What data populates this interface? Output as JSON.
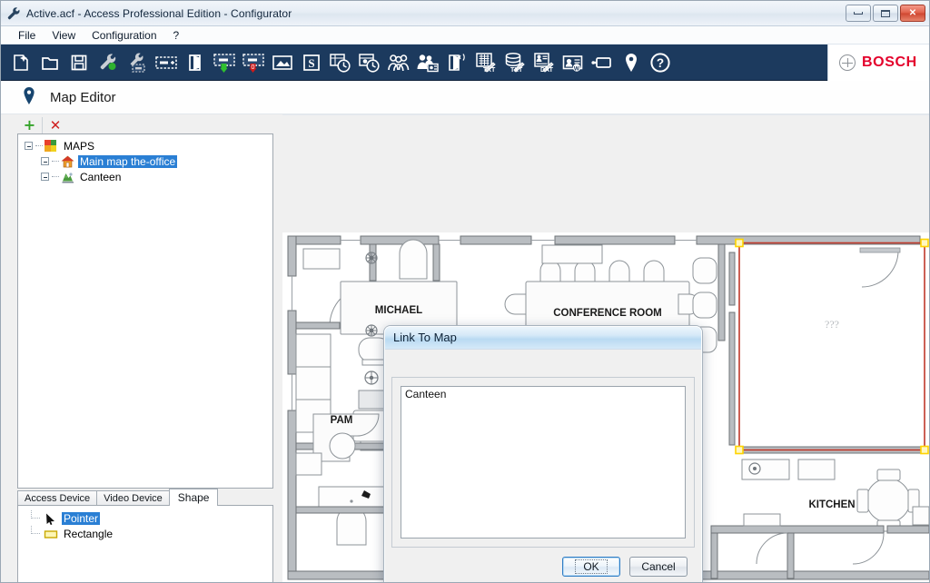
{
  "window": {
    "title": "Active.acf - Access Professional Edition - Configurator",
    "icon": "wrench-icon",
    "controls": {
      "minimize": "minimize-button",
      "maximize": "maximize-button",
      "close": "close-button"
    }
  },
  "menubar": {
    "items": [
      {
        "label": "File"
      },
      {
        "label": "View"
      },
      {
        "label": "Configuration"
      },
      {
        "label": "?"
      }
    ]
  },
  "toolbar": {
    "buttons": [
      {
        "icon": "new-file-icon",
        "tip": "New"
      },
      {
        "icon": "open-folder-icon",
        "tip": "Open"
      },
      {
        "icon": "save-floppy-icon",
        "tip": "Save"
      },
      {
        "icon": "wrench-green-icon",
        "tip": "System parameters"
      },
      {
        "icon": "wrench-card-icon",
        "tip": "Card definition"
      },
      {
        "icon": "card-reader-icon",
        "tip": "Entrances"
      },
      {
        "icon": "door-icon",
        "tip": "Doors"
      },
      {
        "icon": "card-green-arrow-icon",
        "tip": "Entrance"
      },
      {
        "icon": "card-red-arrow-icon",
        "tip": "Exit"
      },
      {
        "icon": "area-icon",
        "tip": "Areas"
      },
      {
        "icon": "s-calendar-icon",
        "tip": "Special days"
      },
      {
        "icon": "day-model-clock-icon",
        "tip": "Day models"
      },
      {
        "icon": "time-model-clock-icon",
        "tip": "Time models"
      },
      {
        "icon": "persons-group-icon",
        "tip": "Person groups"
      },
      {
        "icon": "person-card-icon",
        "tip": "Personnel"
      },
      {
        "icon": "reader-signal-icon",
        "tip": "Reader configuration"
      },
      {
        "icon": "txt-report-icon",
        "tip": "Text export"
      },
      {
        "icon": "db-txt-icon",
        "tip": "Database text"
      },
      {
        "icon": "data-report-icon",
        "tip": "Data export"
      },
      {
        "icon": "card-w-icon",
        "tip": "Word badge"
      },
      {
        "icon": "video-camera-icon",
        "tip": "Video devices"
      },
      {
        "icon": "map-pin-icon",
        "tip": "Map editor"
      },
      {
        "icon": "help-question-icon",
        "tip": "Help"
      }
    ],
    "brand": {
      "name": "BOSCH",
      "color": "#e4002b",
      "emblem": "bosch-emblem-icon"
    }
  },
  "page": {
    "icon": "map-pin-icon",
    "title": "Map Editor"
  },
  "tree_toolbar": {
    "add": {
      "icon": "plus-icon",
      "label": "+"
    },
    "delete": {
      "icon": "delete-x-icon",
      "label": "✕"
    }
  },
  "tree": {
    "nodes": [
      {
        "label": "MAPS",
        "level": 0,
        "icon": "maps-folder-icon",
        "selected": false,
        "expanded": true
      },
      {
        "label": "Main map the-office",
        "level": 1,
        "icon": "house-icon",
        "selected": true,
        "expanded": true
      },
      {
        "label": "Canteen",
        "level": 1,
        "icon": "canteen-icon",
        "selected": false,
        "expanded": true
      }
    ]
  },
  "panel_tabs": {
    "items": [
      {
        "label": "Access Device",
        "active": false
      },
      {
        "label": "Video Device",
        "active": false
      },
      {
        "label": "Shape",
        "active": true
      }
    ]
  },
  "shape_list": {
    "items": [
      {
        "label": "Pointer",
        "icon": "pointer-arrow-icon",
        "selected": true
      },
      {
        "label": "Rectangle",
        "icon": "yellow-rectangle-icon",
        "selected": false
      }
    ]
  },
  "map_canvas": {
    "background_color": "#f0f0f0",
    "room_labels": [
      {
        "text": "MICHAEL"
      },
      {
        "text": "CONFERENCE ROOM"
      },
      {
        "text": "PAM"
      },
      {
        "text": "KITCHEN"
      },
      {
        "text": "???"
      }
    ],
    "selection": {
      "name": "rectangle-shape-selection",
      "stroke_color": "#c0392b",
      "handle_color": "#ffd400",
      "label": "???"
    }
  },
  "dialog": {
    "title": "Link To Map",
    "list": {
      "items": [
        {
          "label": "Canteen",
          "selected": false
        }
      ]
    },
    "buttons": {
      "ok": {
        "label": "OK",
        "focused": true
      },
      "cancel": {
        "label": "Cancel",
        "focused": false
      }
    }
  }
}
